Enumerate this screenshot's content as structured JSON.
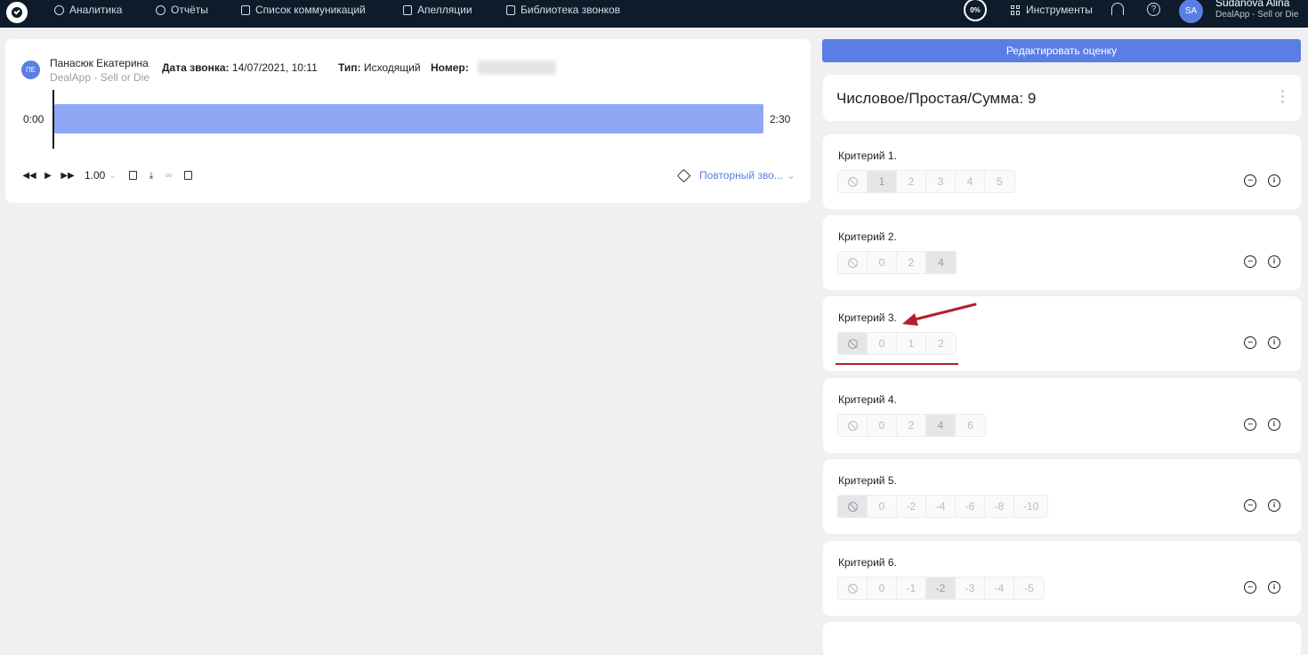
{
  "topbar": {
    "nav": [
      {
        "label": "Аналитика",
        "icon": "gauge-icon"
      },
      {
        "label": "Отчёты",
        "icon": "pie-chart-icon"
      },
      {
        "label": "Список коммуникаций",
        "icon": "table-icon"
      },
      {
        "label": "Апелляции",
        "icon": "appeal-document-icon"
      },
      {
        "label": "Библиотека звонков",
        "icon": "library-book-icon"
      }
    ],
    "progress": "0%",
    "tools_label": "Инструменты",
    "user": {
      "initials": "SA",
      "name": "Sudanova Alina",
      "org": "DealApp - Sell or Die"
    }
  },
  "call": {
    "operator_initials": "ПЕ",
    "operator_name": "Панасюк Екатерина",
    "operator_org": "DealApp - Sell or Die",
    "date_label": "Дата звонка:",
    "date_value": "14/07/2021, 10:11",
    "type_label": "Тип:",
    "type_value": "Исходящий",
    "number_label": "Номер:",
    "time_start": "0:00",
    "time_end": "2:30",
    "speed": "1.00",
    "repeat_label": "Повторный зво..."
  },
  "evaluation": {
    "edit_button": "Редактировать оценку",
    "score_title": "Числовое/Простая/Сумма: 9",
    "criteria": [
      {
        "title": "Критерий 1.",
        "options": [
          "1",
          "2",
          "3",
          "4",
          "5"
        ],
        "selected": "1"
      },
      {
        "title": "Критерий 2.",
        "options": [
          "0",
          "2",
          "4"
        ],
        "selected": "4"
      },
      {
        "title": "Критерий 3.",
        "options": [
          "0",
          "1",
          "2"
        ],
        "selected": "n/a"
      },
      {
        "title": "Критерий 4.",
        "options": [
          "0",
          "2",
          "4",
          "6"
        ],
        "selected": "4"
      },
      {
        "title": "Критерий 5.",
        "options": [
          "0",
          "-2",
          "-4",
          "-6",
          "-8",
          "-10"
        ],
        "selected": "n/a"
      },
      {
        "title": "Критерий 6.",
        "options": [
          "0",
          "-1",
          "-2",
          "-3",
          "-4",
          "-5"
        ],
        "selected": "-2"
      }
    ]
  },
  "colors": {
    "topbar": "#0d1b2a",
    "accent": "#5b7ee5",
    "waveform": "#8fa8f5",
    "annotation": "#b3202a"
  }
}
